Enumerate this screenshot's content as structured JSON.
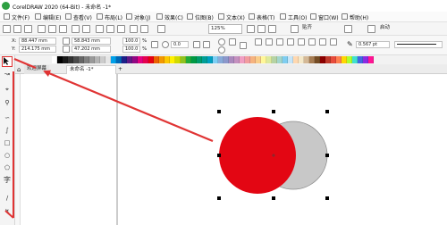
{
  "window": {
    "title": "CorelDRAW 2020 (64-Bit) - 未命名 -1*"
  },
  "menu": {
    "items": [
      "文件(F)",
      "编辑(E)",
      "查看(V)",
      "布局(L)",
      "对象(J)",
      "效果(C)",
      "位图(B)",
      "文本(X)",
      "表格(T)",
      "工具(O)",
      "窗口(W)",
      "帮助(H)"
    ]
  },
  "toolbar": {
    "zoom_value": "125%",
    "snap_label": "贴齐",
    "launch_label": "启动"
  },
  "property_bar": {
    "x_label": "X:",
    "x_value": "88.447 mm",
    "y_label": "Y:",
    "y_value": "214.175 mm",
    "width_value": "58.843 mm",
    "height_value": "47.202 mm",
    "scale_x": "100.0",
    "scale_y": "100.0",
    "percent_sign": "%",
    "rotation_value": "0.0",
    "outline_width": "0.567 pt"
  },
  "tabs": {
    "welcome": "欢迎屏幕",
    "document": "未命名 -1*"
  },
  "palette": {
    "colors": [
      "#ffffff",
      "#000000",
      "#1a1a1a",
      "#333333",
      "#4d4d4d",
      "#666666",
      "#808080",
      "#999999",
      "#b3b3b3",
      "#cccccc",
      "#e6e6e6",
      "#00a0e9",
      "#0068b7",
      "#1d2088",
      "#601986",
      "#920783",
      "#e4007f",
      "#e5004f",
      "#e60012",
      "#eb6100",
      "#f39800",
      "#fcc800",
      "#fff100",
      "#cfdb00",
      "#8fc31f",
      "#22ac38",
      "#009944",
      "#009b6b",
      "#009e96",
      "#00a0c1",
      "#7ecef4",
      "#88abda",
      "#8c97cb",
      "#aa89bd",
      "#c490bf",
      "#f19ec2",
      "#f29c9f",
      "#f6b37f",
      "#facd89",
      "#fff799",
      "#ddea9c",
      "#b5d3a4",
      "#a3d6cc",
      "#7fcdf0",
      "#c7e5f8",
      "#ffd8b0",
      "#f5e8c8",
      "#d4b896",
      "#a67c52",
      "#754c24",
      "#8b0000",
      "#c0392b",
      "#e74c3c",
      "#ff7f50",
      "#ffd700",
      "#adff2f",
      "#40e0d0",
      "#4169e1",
      "#8a2be2",
      "#ff1493"
    ]
  },
  "shapes": {
    "red_circle_fill": "#e30613",
    "gray_circle_fill": "#c8c8c8"
  }
}
